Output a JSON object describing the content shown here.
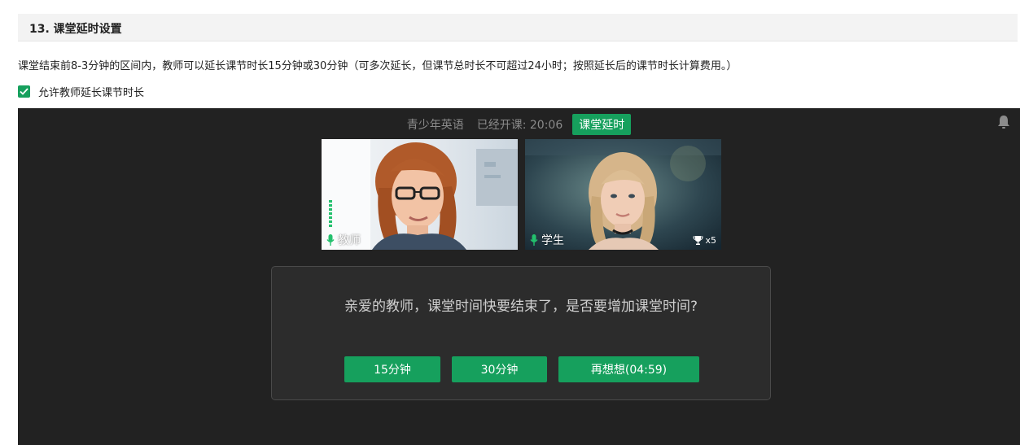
{
  "section": {
    "title": "13. 课堂延时设置",
    "description": "课堂结束前8-3分钟的区间内，教师可以延长课节时长15分钟或30分钟（可多次延长，但课节总时长不可超过24小时；按照延长后的课节时长计算费用。）"
  },
  "setting": {
    "checked": true,
    "label": "允许教师延长课节时长"
  },
  "classroom": {
    "course_name": "青少年英语",
    "elapsed_text": "已经开课: 20:06",
    "extend_badge": "课堂延时",
    "teacher_label": "教师",
    "student_label": "学生",
    "trophy_count": "x5"
  },
  "dialog": {
    "message": "亲爱的教师，课堂时间快要结束了，是否要增加课堂时间?",
    "buttons": {
      "extend_15": "15分钟",
      "extend_30": "30分钟",
      "later": "再想想(04:59)"
    }
  },
  "colors": {
    "accent_green": "#16a05d",
    "classroom_bg": "#222222",
    "dialog_bg": "#2c2c2c"
  },
  "icons": {
    "checkbox": "check-icon",
    "bell": "bell-icon",
    "mic": "mic-icon",
    "trophy": "trophy-icon"
  }
}
